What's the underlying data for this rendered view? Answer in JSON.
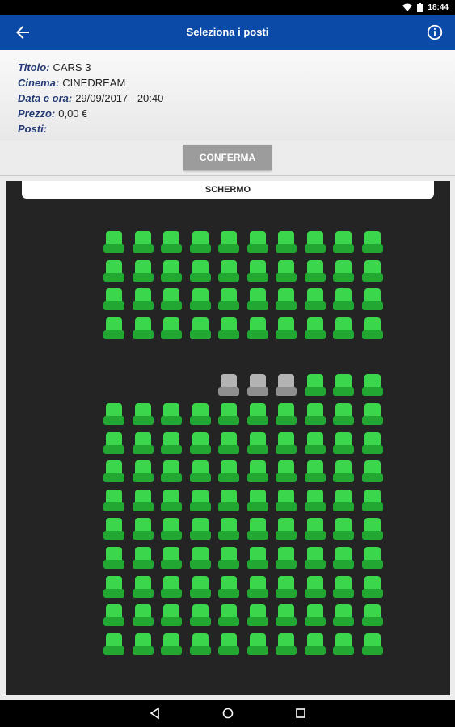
{
  "status_bar": {
    "time": "18:44"
  },
  "app_bar": {
    "title": "Seleziona i posti",
    "back_icon": "arrow-left-icon",
    "info_icon": "info-circle-icon"
  },
  "details": {
    "title_label": "Titolo:",
    "title_value": "CARS 3",
    "cinema_label": "Cinema:",
    "cinema_value": "CINEDREAM",
    "datetime_label": "Data e ora:",
    "datetime_value": "29/09/2017 - 20:40",
    "price_label": "Prezzo:",
    "price_value": "0,00 €",
    "seats_label": "Posti:",
    "seats_value": ""
  },
  "confirm_button": {
    "label": "CONFERMA"
  },
  "screen_label": "SCHERMO",
  "seat_map": {
    "columns": 10,
    "rows": [
      {
        "status": [
          "free",
          "free",
          "free",
          "free",
          "free",
          "free",
          "free",
          "free",
          "free",
          "free"
        ]
      },
      {
        "status": [
          "free",
          "free",
          "free",
          "free",
          "free",
          "free",
          "free",
          "free",
          "free",
          "free"
        ]
      },
      {
        "status": [
          "free",
          "free",
          "free",
          "free",
          "free",
          "free",
          "free",
          "free",
          "free",
          "free"
        ]
      },
      {
        "status": [
          "free",
          "free",
          "free",
          "free",
          "free",
          "free",
          "free",
          "free",
          "free",
          "free"
        ]
      },
      {
        "status": [
          "none",
          "none",
          "none",
          "none",
          "taken",
          "taken",
          "taken",
          "free",
          "free",
          "free"
        ],
        "gap_before": true
      },
      {
        "status": [
          "free",
          "free",
          "free",
          "free",
          "free",
          "free",
          "free",
          "free",
          "free",
          "free"
        ]
      },
      {
        "status": [
          "free",
          "free",
          "free",
          "free",
          "free",
          "free",
          "free",
          "free",
          "free",
          "free"
        ]
      },
      {
        "status": [
          "free",
          "free",
          "free",
          "free",
          "free",
          "free",
          "free",
          "free",
          "free",
          "free"
        ]
      },
      {
        "status": [
          "free",
          "free",
          "free",
          "free",
          "free",
          "free",
          "free",
          "free",
          "free",
          "free"
        ]
      },
      {
        "status": [
          "free",
          "free",
          "free",
          "free",
          "free",
          "free",
          "free",
          "free",
          "free",
          "free"
        ]
      },
      {
        "status": [
          "free",
          "free",
          "free",
          "free",
          "free",
          "free",
          "free",
          "free",
          "free",
          "free"
        ]
      },
      {
        "status": [
          "free",
          "free",
          "free",
          "free",
          "free",
          "free",
          "free",
          "free",
          "free",
          "free"
        ]
      },
      {
        "status": [
          "free",
          "free",
          "free",
          "free",
          "free",
          "free",
          "free",
          "free",
          "free",
          "free"
        ]
      },
      {
        "status": [
          "free",
          "free",
          "free",
          "free",
          "free",
          "free",
          "free",
          "free",
          "free",
          "free"
        ]
      }
    ]
  },
  "colors": {
    "app_bar": "#0b4aa7",
    "seat_free": "#3bd64b",
    "seat_taken": "#b3b3b3",
    "hall": "#242424"
  },
  "nav_bar": {
    "back_icon": "nav-back-icon",
    "home_icon": "nav-home-icon",
    "recents_icon": "nav-recents-icon"
  }
}
